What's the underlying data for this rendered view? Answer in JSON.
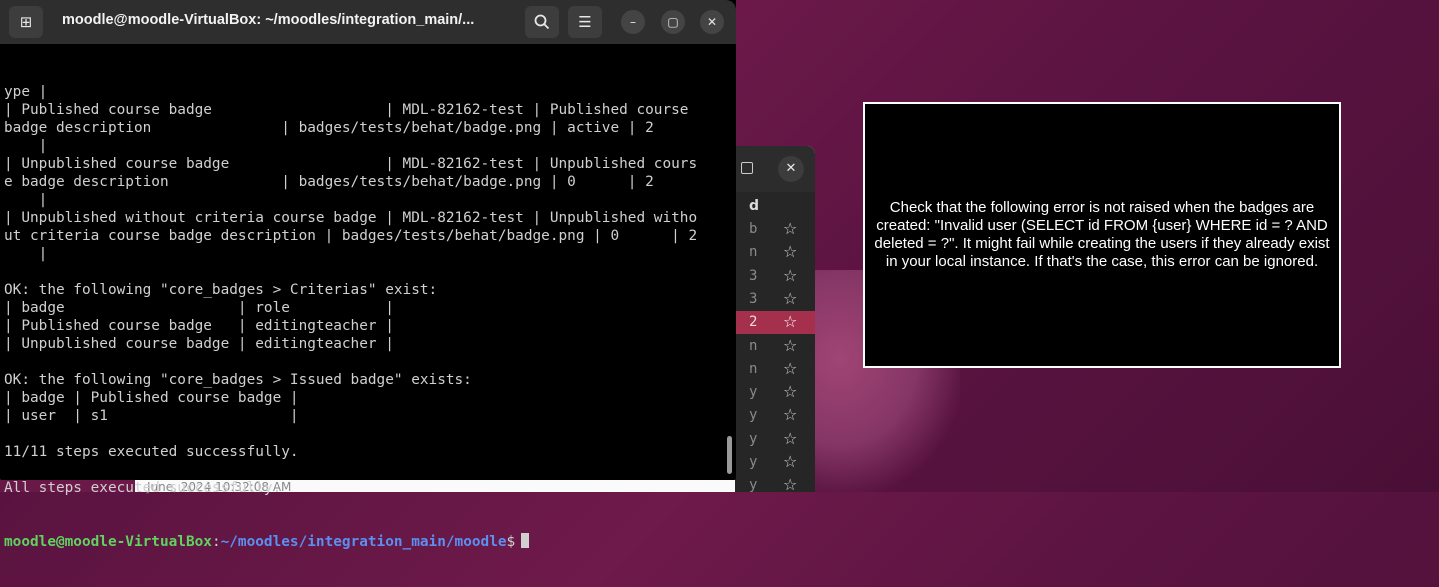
{
  "terminal": {
    "title": "moodle@moodle-VirtualBox: ~/moodles/integration_main/...",
    "lines": [
      "ype |",
      "| Published course badge                    | MDL-82162-test | Published course",
      "badge description               | badges/tests/behat/badge.png | active | 2",
      "    |",
      "| Unpublished course badge                  | MDL-82162-test | Unpublished cours",
      "e badge description             | badges/tests/behat/badge.png | 0      | 2",
      "    |",
      "| Unpublished without criteria course badge | MDL-82162-test | Unpublished witho",
      "ut criteria course badge description | badges/tests/behat/badge.png | 0      | 2",
      "    |",
      "",
      "OK: the following \"core_badges > Criterias\" exist:",
      "| badge                    | role           |",
      "| Published course badge   | editingteacher |",
      "| Unpublished course badge | editingteacher |",
      "",
      "OK: the following \"core_badges > Issued badge\" exists:",
      "| badge | Published course badge |",
      "| user  | s1                     |",
      "",
      "11/11 steps executed successfully.",
      "",
      "All steps executed successfully."
    ],
    "prompt_user": "moodle@moodle-VirtualBox",
    "prompt_sep": ":",
    "prompt_path": "~/moodles/integration_main/moodle",
    "prompt_symbol": "$"
  },
  "background_window": {
    "column_header": "d",
    "rows": [
      {
        "ch": "b",
        "selected": false
      },
      {
        "ch": "n",
        "selected": false
      },
      {
        "ch": "3",
        "selected": false
      },
      {
        "ch": "3",
        "selected": false
      },
      {
        "ch": "2",
        "selected": true
      },
      {
        "ch": "n",
        "selected": false
      },
      {
        "ch": "n",
        "selected": false
      },
      {
        "ch": "y",
        "selected": false
      },
      {
        "ch": "y",
        "selected": false
      },
      {
        "ch": "y",
        "selected": false
      },
      {
        "ch": "y",
        "selected": false
      },
      {
        "ch": "y",
        "selected": false
      }
    ],
    "footer": "June, 2024 10:32:08 AM"
  },
  "notification": {
    "text": "Check that the following error is not raised when the badges are created: \"Invalid user (SELECT id FROM {user} WHERE id = ? AND deleted = ?\". It might fail while creating the users if they already exist in your local instance. If that's the case, this error can be ignored."
  },
  "colors": {
    "desktop": "#6e1a4a",
    "selected_row": "#a4304d",
    "prompt_user": "#5fd35f",
    "prompt_path": "#5b8ff0"
  }
}
